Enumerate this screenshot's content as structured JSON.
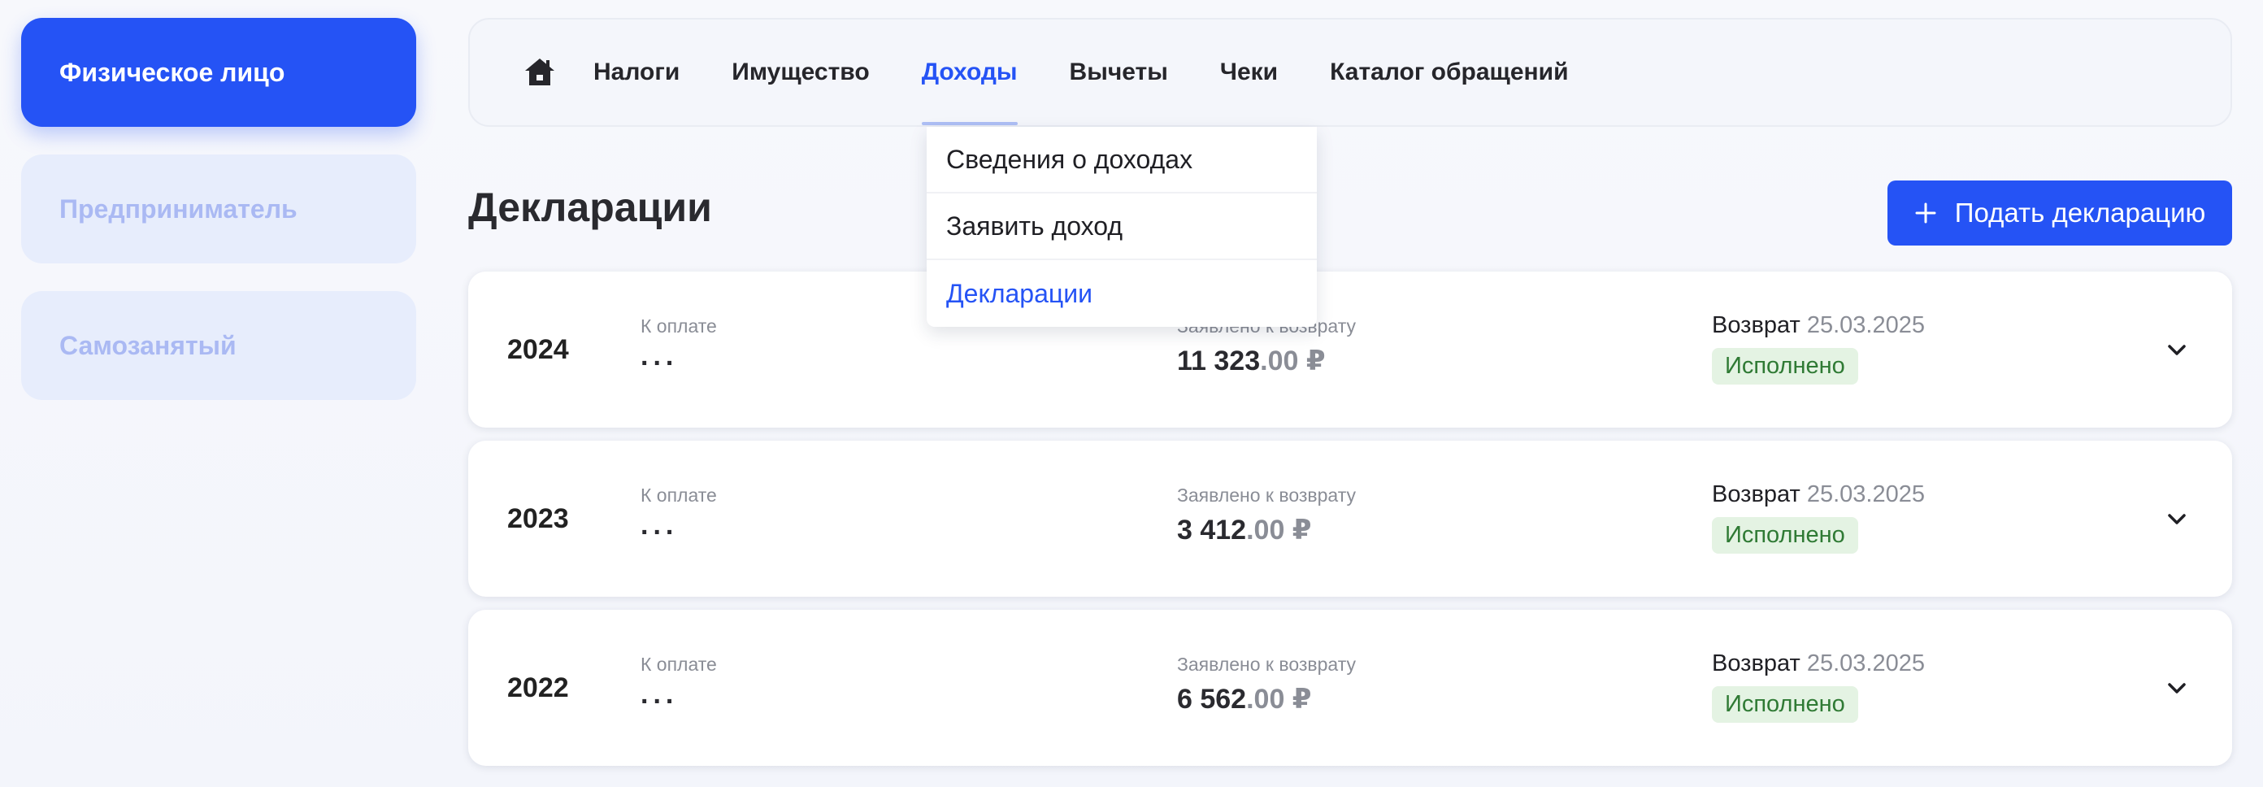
{
  "sidebar": {
    "roles": [
      {
        "label": "Физическое лицо"
      },
      {
        "label": "Предприниматель"
      },
      {
        "label": "Самозанятый"
      }
    ]
  },
  "nav": {
    "items": [
      {
        "label": "Налоги"
      },
      {
        "label": "Имущество"
      },
      {
        "label": "Доходы"
      },
      {
        "label": "Вычеты"
      },
      {
        "label": "Чеки"
      },
      {
        "label": "Каталог обращений"
      }
    ]
  },
  "dropdown": {
    "items": [
      {
        "label": "Сведения о доходах"
      },
      {
        "label": "Заявить доход"
      },
      {
        "label": "Декларации"
      }
    ]
  },
  "page": {
    "title": "Декларации",
    "submit_label": "Подать декларацию"
  },
  "declarations": [
    {
      "year": "2024",
      "pay_label": "К оплате",
      "pay_value": "...",
      "claimed_label": "Заявлено к возврату",
      "claimed_main": "11 323",
      "claimed_cents": ".00 ₽",
      "refund_label": "Возврат",
      "refund_date": "25.03.2025",
      "status": "Исполнено"
    },
    {
      "year": "2023",
      "pay_label": "К оплате",
      "pay_value": "...",
      "claimed_label": "Заявлено к возврату",
      "claimed_main": "3 412",
      "claimed_cents": ".00 ₽",
      "refund_label": "Возврат",
      "refund_date": "25.03.2025",
      "status": "Исполнено"
    },
    {
      "year": "2022",
      "pay_label": "К оплате",
      "pay_value": "...",
      "claimed_label": "Заявлено к возврату",
      "claimed_main": "6 562",
      "claimed_cents": ".00 ₽",
      "refund_label": "Возврат",
      "refund_date": "25.03.2025",
      "status": "Исполнено"
    }
  ],
  "icons": {
    "home": "home-icon",
    "plus": "plus-icon",
    "chevron": "chevron-down-icon"
  },
  "colors": {
    "accent": "#2553f5",
    "status_bg": "#e4f3e3",
    "status_text": "#2f7a34",
    "muted": "#8a8d96"
  }
}
